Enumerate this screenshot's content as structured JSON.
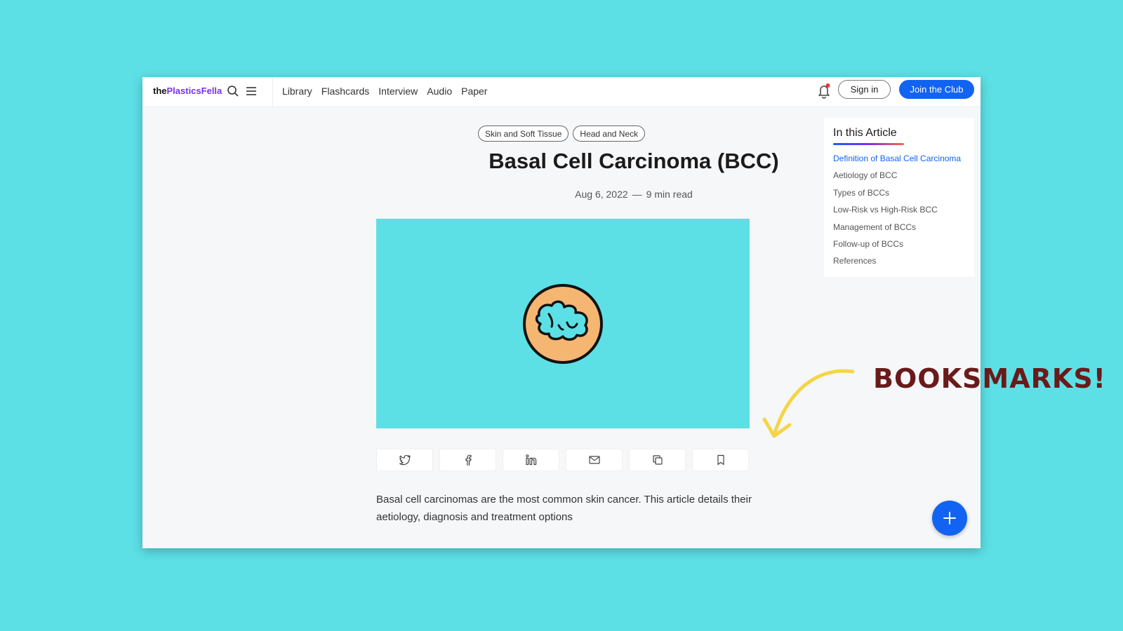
{
  "header": {
    "logo_prefix": "the",
    "logo_brand": "PlasticsFella",
    "nav": [
      "Library",
      "Flashcards",
      "Interview",
      "Audio",
      "Paper"
    ],
    "signin_label": "Sign in",
    "join_label": "Join the Club",
    "notification_dot_color": "#e53935"
  },
  "article": {
    "tags": [
      "Skin and Soft Tissue",
      "Head and Neck"
    ],
    "title": "Basal Cell Carcinoma (BCC)",
    "date": "Aug 6, 2022",
    "dash": "—",
    "read_time": "9 min read",
    "intro": "Basal cell carcinomas are the most common skin cancer. This article details their aetiology, diagnosis and treatment options"
  },
  "share_icons": [
    "twitter-icon",
    "facebook-icon",
    "linkedin-icon",
    "mail-icon",
    "copy-icon",
    "bookmark-icon"
  ],
  "toc": {
    "title": "In this Article",
    "items": [
      "Definition of Basal Cell Carcinoma",
      "Aetiology of BCC",
      "Types of BCCs",
      "Low-Risk vs High-Risk BCC",
      "Management of BCCs",
      "Follow-up of BCCs",
      "References"
    ],
    "active_index": 0
  },
  "annotation": {
    "text": "BOOKSMARKS!",
    "color": "#6b1a1a",
    "arrow_color": "#f5d547"
  },
  "colors": {
    "background": "#5ce0e5",
    "accent": "#1263f1",
    "brand_purple": "#7b2ff7"
  }
}
